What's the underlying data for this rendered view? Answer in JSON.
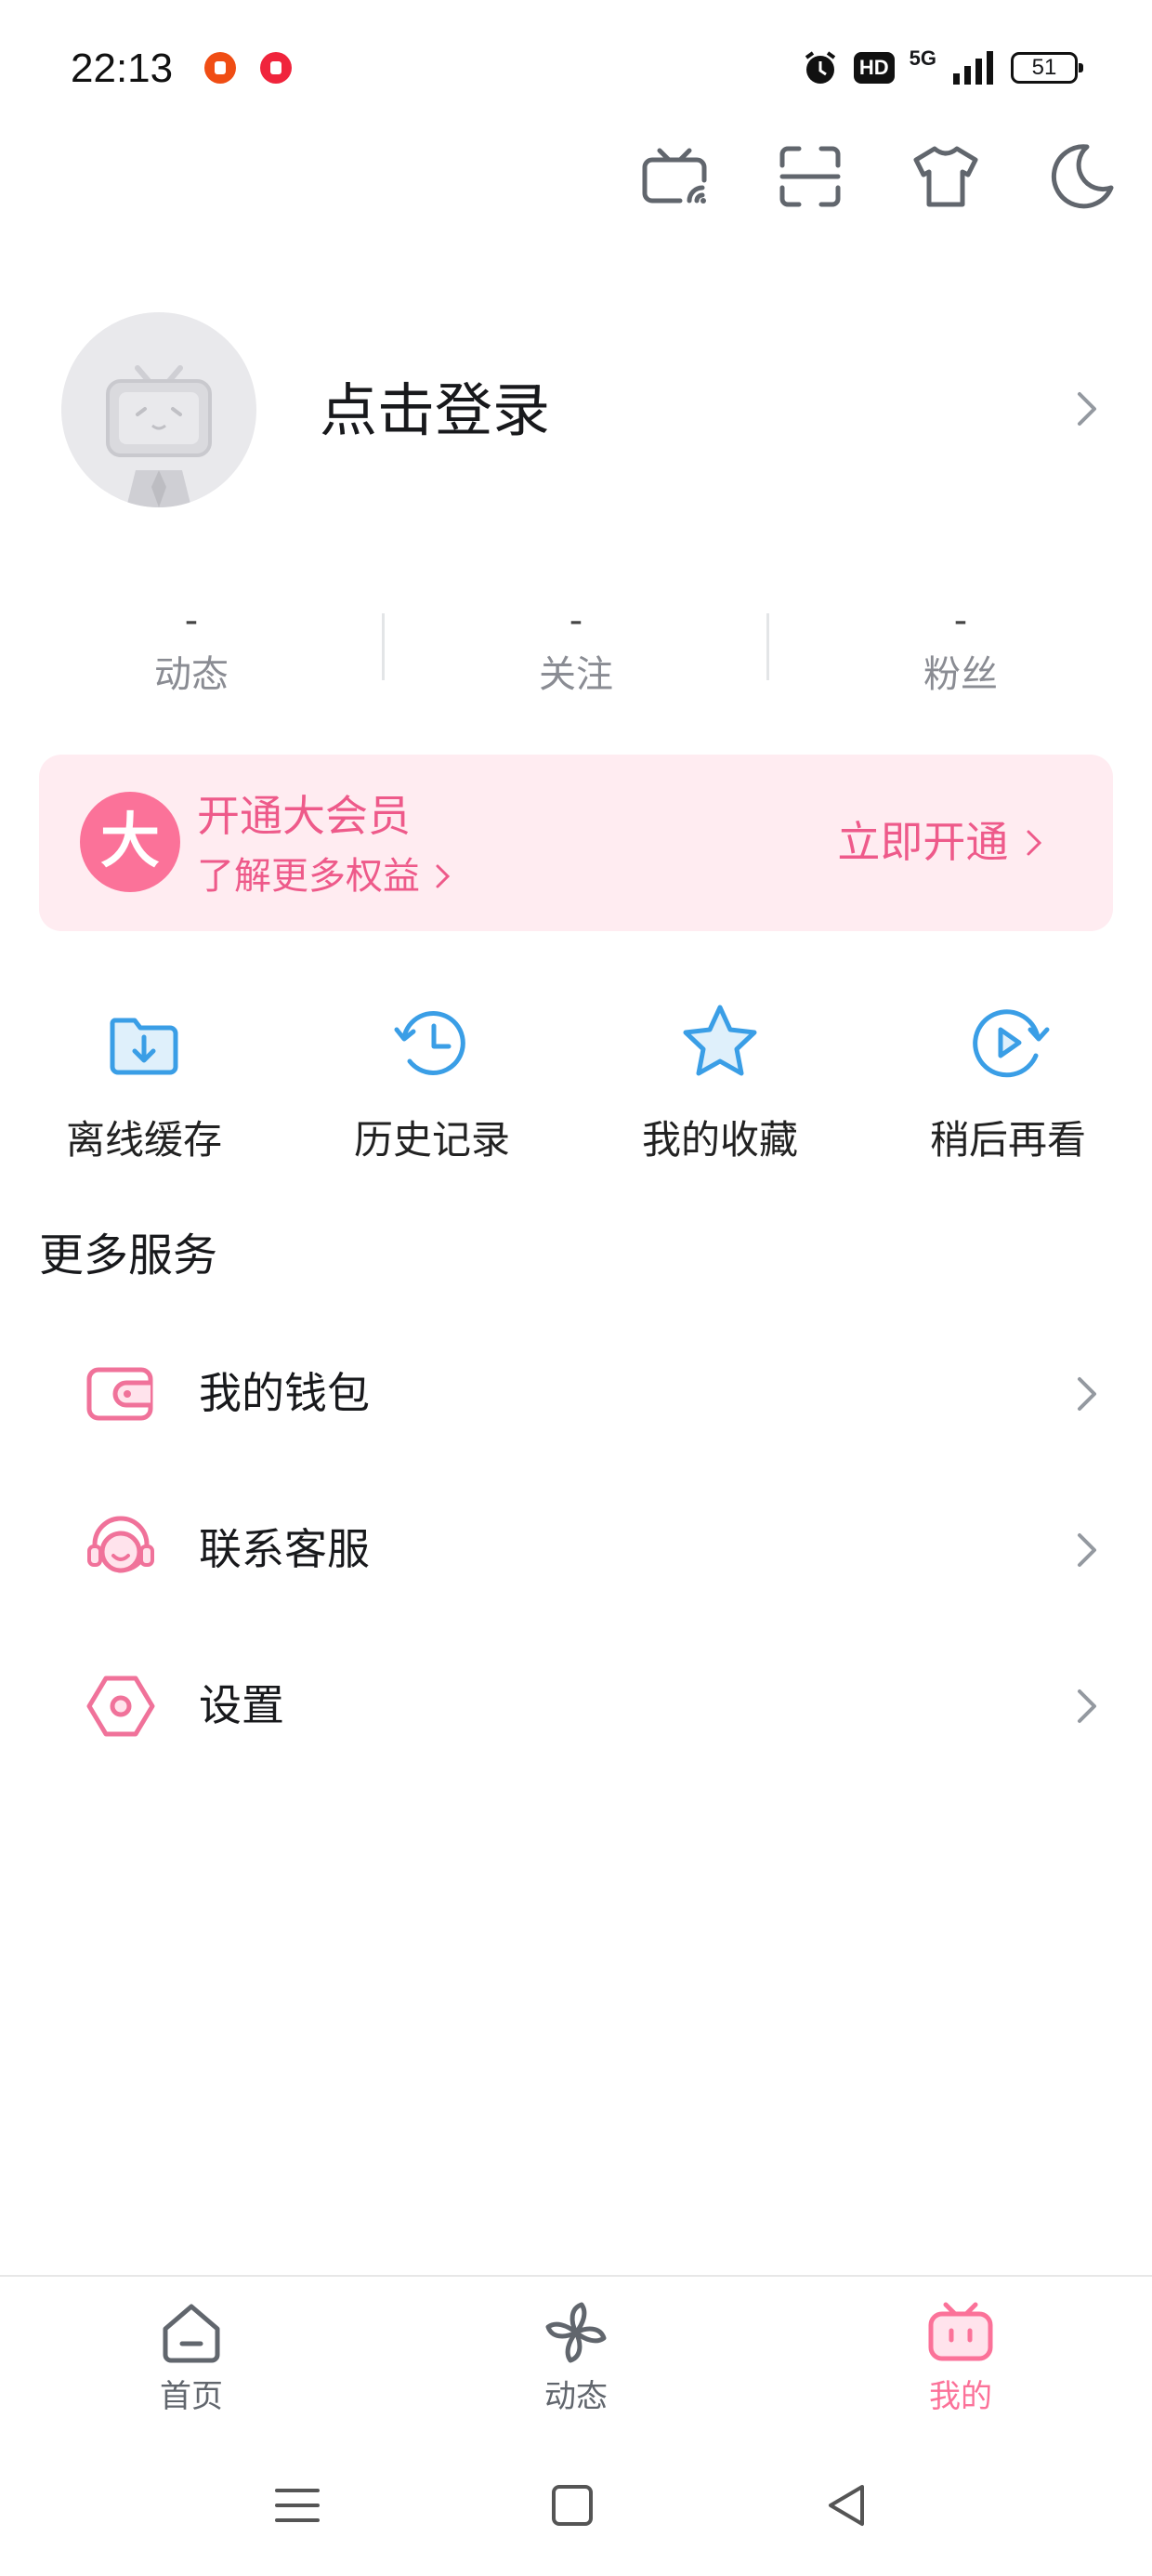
{
  "status_bar": {
    "time": "22:13",
    "network": "5G",
    "hd_badge": "HD",
    "battery": "51"
  },
  "top_icons": [
    "tv-cast-icon",
    "scan-icon",
    "shirt-icon",
    "moon-icon"
  ],
  "profile": {
    "login_label": "点击登录"
  },
  "stats": [
    {
      "value": "-",
      "label": "动态"
    },
    {
      "value": "-",
      "label": "关注"
    },
    {
      "value": "-",
      "label": "粉丝"
    }
  ],
  "vip": {
    "badge": "大",
    "title": "开通大会员",
    "subtitle": "了解更多权益",
    "cta": "立即开通",
    "accent_color": "#fb7299"
  },
  "quick_actions": [
    {
      "label": "离线缓存",
      "icon": "download-folder-icon"
    },
    {
      "label": "历史记录",
      "icon": "history-clock-icon"
    },
    {
      "label": "我的收藏",
      "icon": "star-icon"
    },
    {
      "label": "稍后再看",
      "icon": "watch-later-icon"
    }
  ],
  "more_services": {
    "title": "更多服务",
    "items": [
      {
        "label": "我的钱包",
        "icon": "wallet-icon"
      },
      {
        "label": "联系客服",
        "icon": "customer-service-icon"
      },
      {
        "label": "设置",
        "icon": "settings-hexagon-icon"
      }
    ]
  },
  "tabs": [
    {
      "label": "首页",
      "icon": "home-icon",
      "active": false
    },
    {
      "label": "动态",
      "icon": "pinwheel-icon",
      "active": false
    },
    {
      "label": "我的",
      "icon": "bilibili-tv-icon",
      "active": true
    }
  ],
  "colors": {
    "pink": "#fb7299",
    "blue": "#3a9ee6",
    "gray_text": "#8a8c93"
  }
}
